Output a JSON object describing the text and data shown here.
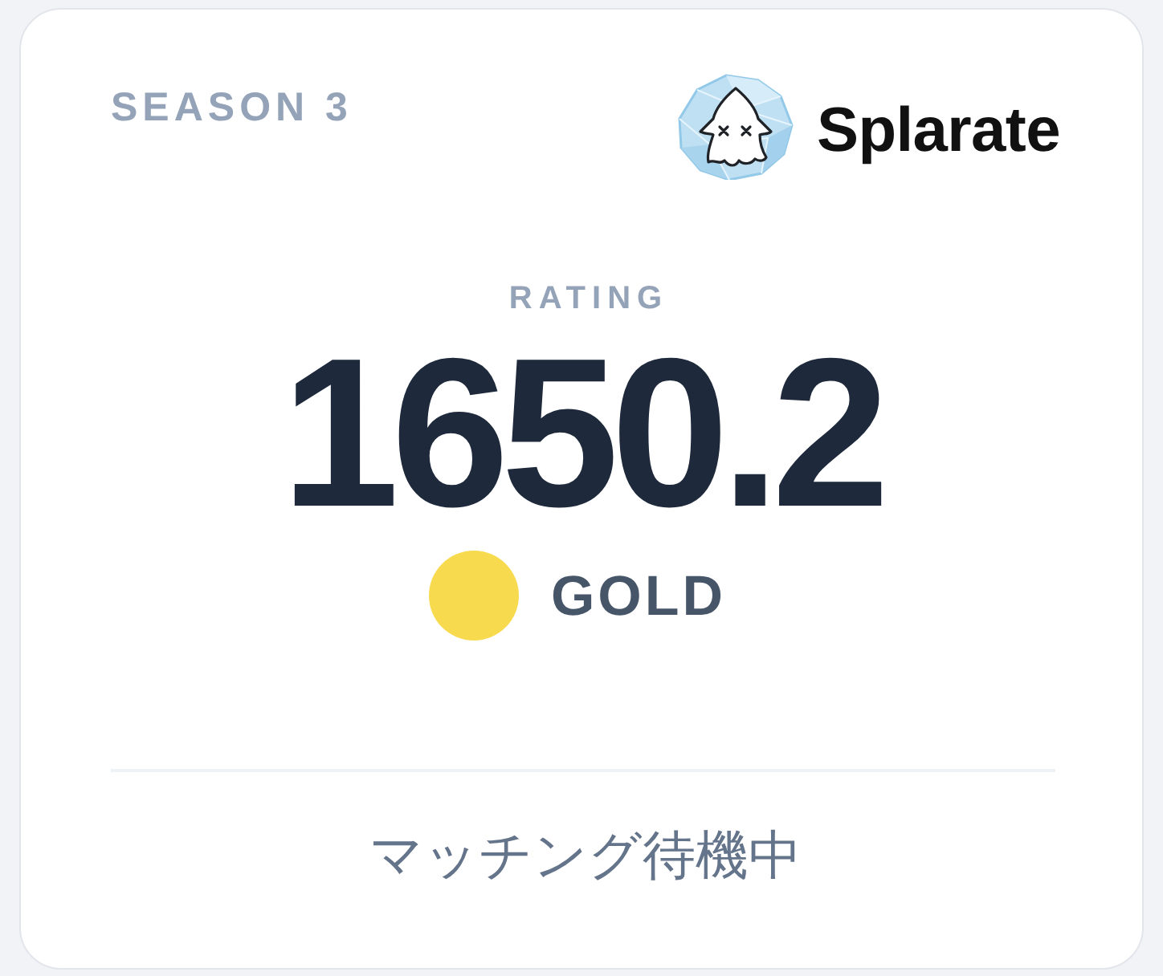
{
  "card": {
    "season": "SEASON 3",
    "brand": "Splarate",
    "rating_label": "RATING",
    "rating": "1650.2",
    "rank": {
      "name": "GOLD",
      "color": "#f8da4e"
    },
    "status": "マッチング待機中"
  }
}
